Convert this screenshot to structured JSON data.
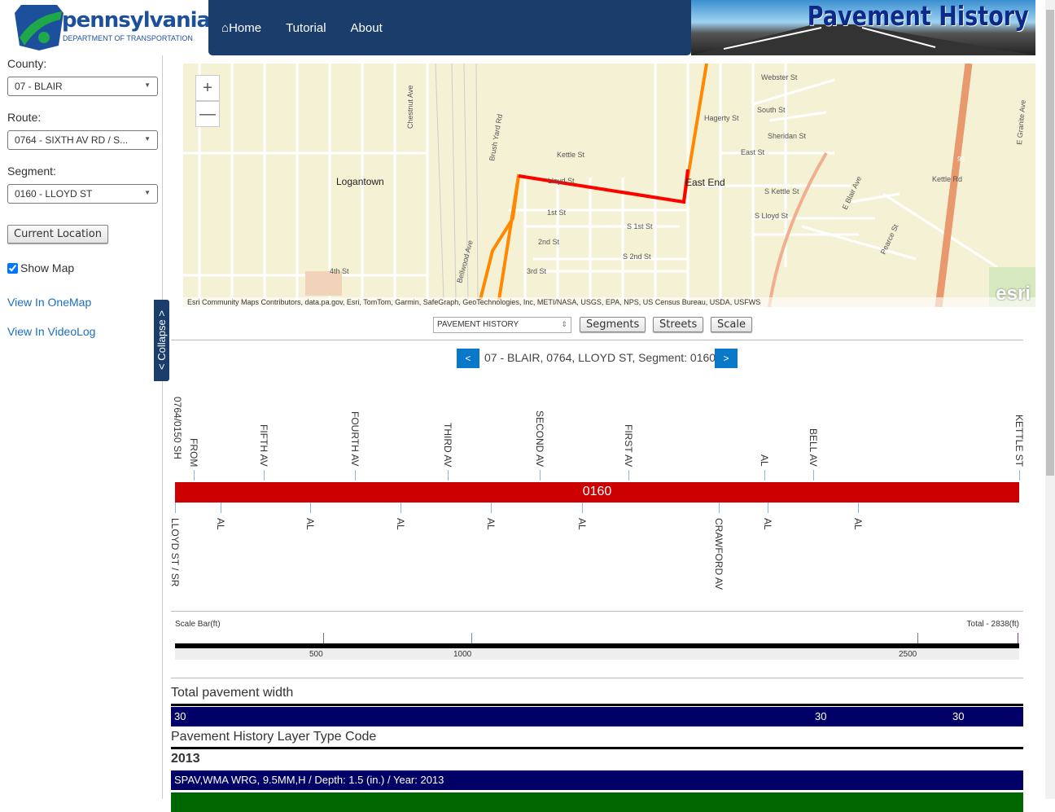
{
  "header": {
    "logo_word": "pennsylvania",
    "logo_sub": "DEPARTMENT OF TRANSPORTATION",
    "nav": [
      "Home",
      "Tutorial",
      "About"
    ],
    "banner_title": "Pavement History"
  },
  "sidebar": {
    "county_label": "County:",
    "county_value": "07 - BLAIR",
    "route_label": "Route:",
    "route_value": "0764 - SIXTH AV RD / S...",
    "segment_label": "Segment:",
    "segment_value": "0160 - LLOYD ST",
    "current_location": "Current Location",
    "show_map": "Show Map",
    "show_map_checked": true,
    "view_onemap": "View In OneMap",
    "view_videolog": "View In VideoLog",
    "collapse": "< Collapse >"
  },
  "map": {
    "labels": [
      "Logantown",
      "East End",
      "Kettle St",
      "Lloyd St",
      "1st St",
      "2nd St",
      "3rd St",
      "4th St",
      "S 1st St",
      "S 2nd St",
      "Hagerty St",
      "South St",
      "Sheridan St",
      "East St",
      "Webster St",
      "S Kettle St",
      "S Lloyd St",
      "Chestnut Ave",
      "Brush Yard Rd",
      "Bellwood Ave",
      "E Blair Ave",
      "Pearce St",
      "E Granite Ave",
      "Kettle Rd",
      "99"
    ],
    "attribution": "Esri Community Maps Contributors, data.pa.gov, Esri, TomTom, Garmin, SafeGraph, GeoTechnologies, Inc, METI/NASA, USGS, EPA, NPS, US Census Bureau, USDA, USFWS",
    "esri": "esri",
    "zoom_in": "+",
    "zoom_out": "—"
  },
  "toolbar": {
    "layer_select": "PAVEMENT HISTORY",
    "segments": "Segments",
    "streets": "Streets",
    "scale": "Scale"
  },
  "segment_nav": {
    "prev": "<",
    "title": "07 - BLAIR, 0764, LLOYD ST, Segment: 0160",
    "next": ">"
  },
  "diagram": {
    "segment": "0160",
    "start_label": "0764/0150 SH",
    "top_labels": [
      "FROM",
      "FIFTH AV",
      "FOURTH AV",
      "THIRD AV",
      "SECOND AV",
      "FIRST AV",
      "AL",
      "BELL AV",
      "KETTLE ST"
    ],
    "bottom_labels": [
      "LLOYD ST / SR",
      "AL",
      "AL",
      "AL",
      "AL",
      "AL",
      "CRAWFORD AV",
      "AL",
      "AL"
    ]
  },
  "scale_bar": {
    "title": "Scale Bar(ft)",
    "total": "Total - 2838(ft)",
    "ticks": [
      "500",
      "1000",
      "2500"
    ]
  },
  "width_section": {
    "title": "Total pavement width",
    "values": [
      "30",
      "30",
      "30"
    ],
    "color": "#000066"
  },
  "layer_section": {
    "title": "Pavement History Layer Type Code",
    "year": "2013",
    "layers": [
      {
        "text": "SPAV,WMA WRG, 9.5MM,H / Depth: 1.5 (in.) / Year: 2013",
        "color": "#000066"
      },
      {
        "text": "",
        "color": "#006600"
      }
    ]
  }
}
